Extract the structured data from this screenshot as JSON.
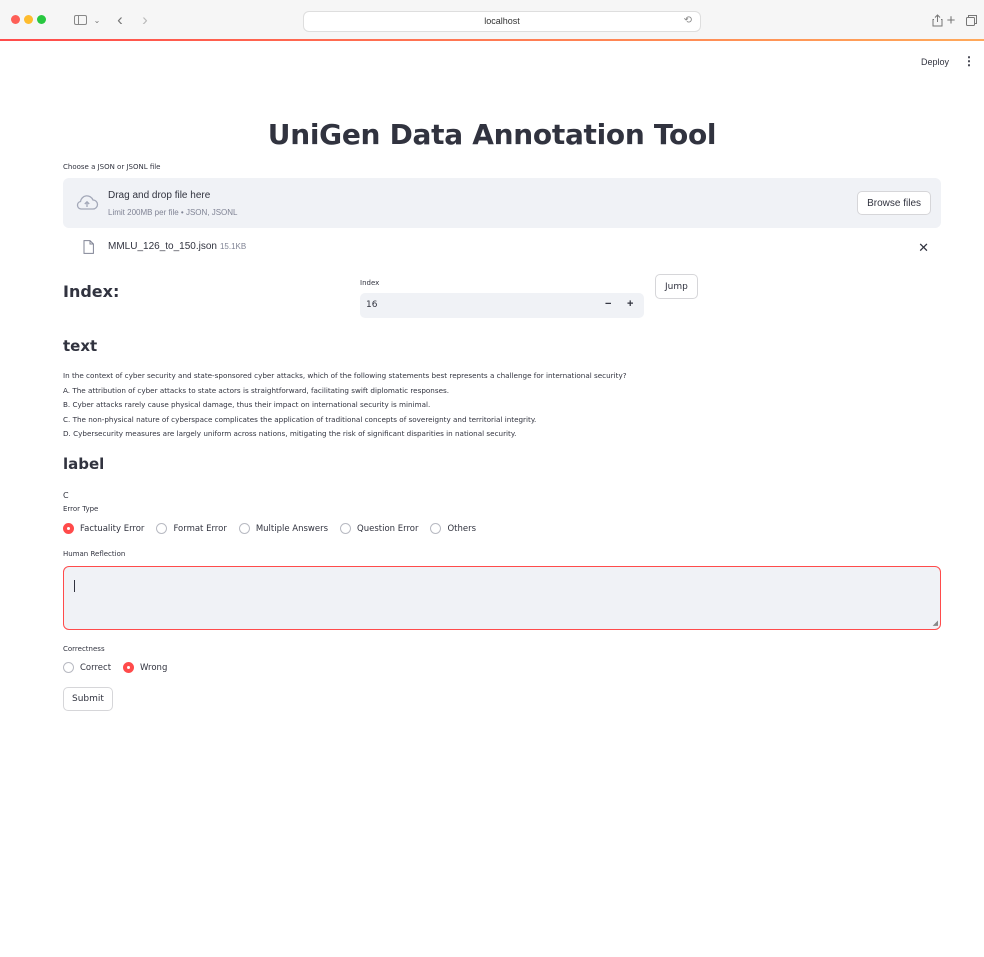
{
  "browser": {
    "url": "localhost",
    "nav_back": "‹",
    "nav_forward": "›",
    "sidebar_icon": "sidebar-icon",
    "share_icon": "share-icon",
    "new_tab_icon": "plus-icon",
    "tabs_icon": "tabs-icon"
  },
  "header": {
    "deploy_label": "Deploy",
    "menu_icon": "⋮"
  },
  "page": {
    "title": "UniGen Data Annotation Tool"
  },
  "uploader": {
    "label": "Choose a JSON or JSONL file",
    "drag_text": "Drag and drop file here",
    "limit_text": "Limit 200MB per file • JSON, JSONL",
    "browse_label": "Browse files",
    "file_name": "MMLU_126_to_150.json",
    "file_size": "15.1KB"
  },
  "index_section": {
    "heading": "Index:",
    "input_label": "Index",
    "value": "16",
    "minus": "−",
    "plus": "+",
    "jump_label": "Jump"
  },
  "text_section": {
    "heading": "text",
    "lines": [
      "In the context of cyber security and state-sponsored cyber attacks, which of the following statements best represents a challenge for international security?",
      "A. The attribution of cyber attacks to state actors is straightforward, facilitating swift diplomatic responses.",
      "B. Cyber attacks rarely cause physical damage, thus their impact on international security is minimal.",
      "C. The non-physical nature of cyberspace complicates the application of traditional concepts of sovereignty and territorial integrity.",
      "D. Cybersecurity measures are largely uniform across nations, mitigating the risk of significant disparities in national security."
    ]
  },
  "label_section": {
    "heading": "label",
    "value": "C"
  },
  "error_type": {
    "label": "Error Type",
    "options": [
      "Factuality Error",
      "Format Error",
      "Multiple Answers",
      "Question Error",
      "Others"
    ],
    "selected": "Factuality Error"
  },
  "reflection": {
    "label": "Human Reflection",
    "value": ""
  },
  "correctness": {
    "label": "Correctness",
    "options": [
      "Correct",
      "Wrong"
    ],
    "selected": "Wrong"
  },
  "submit_label": "Submit",
  "colors": {
    "accent": "#ff4b4b",
    "widget_bg": "#f0f2f6",
    "text": "#31333f"
  }
}
